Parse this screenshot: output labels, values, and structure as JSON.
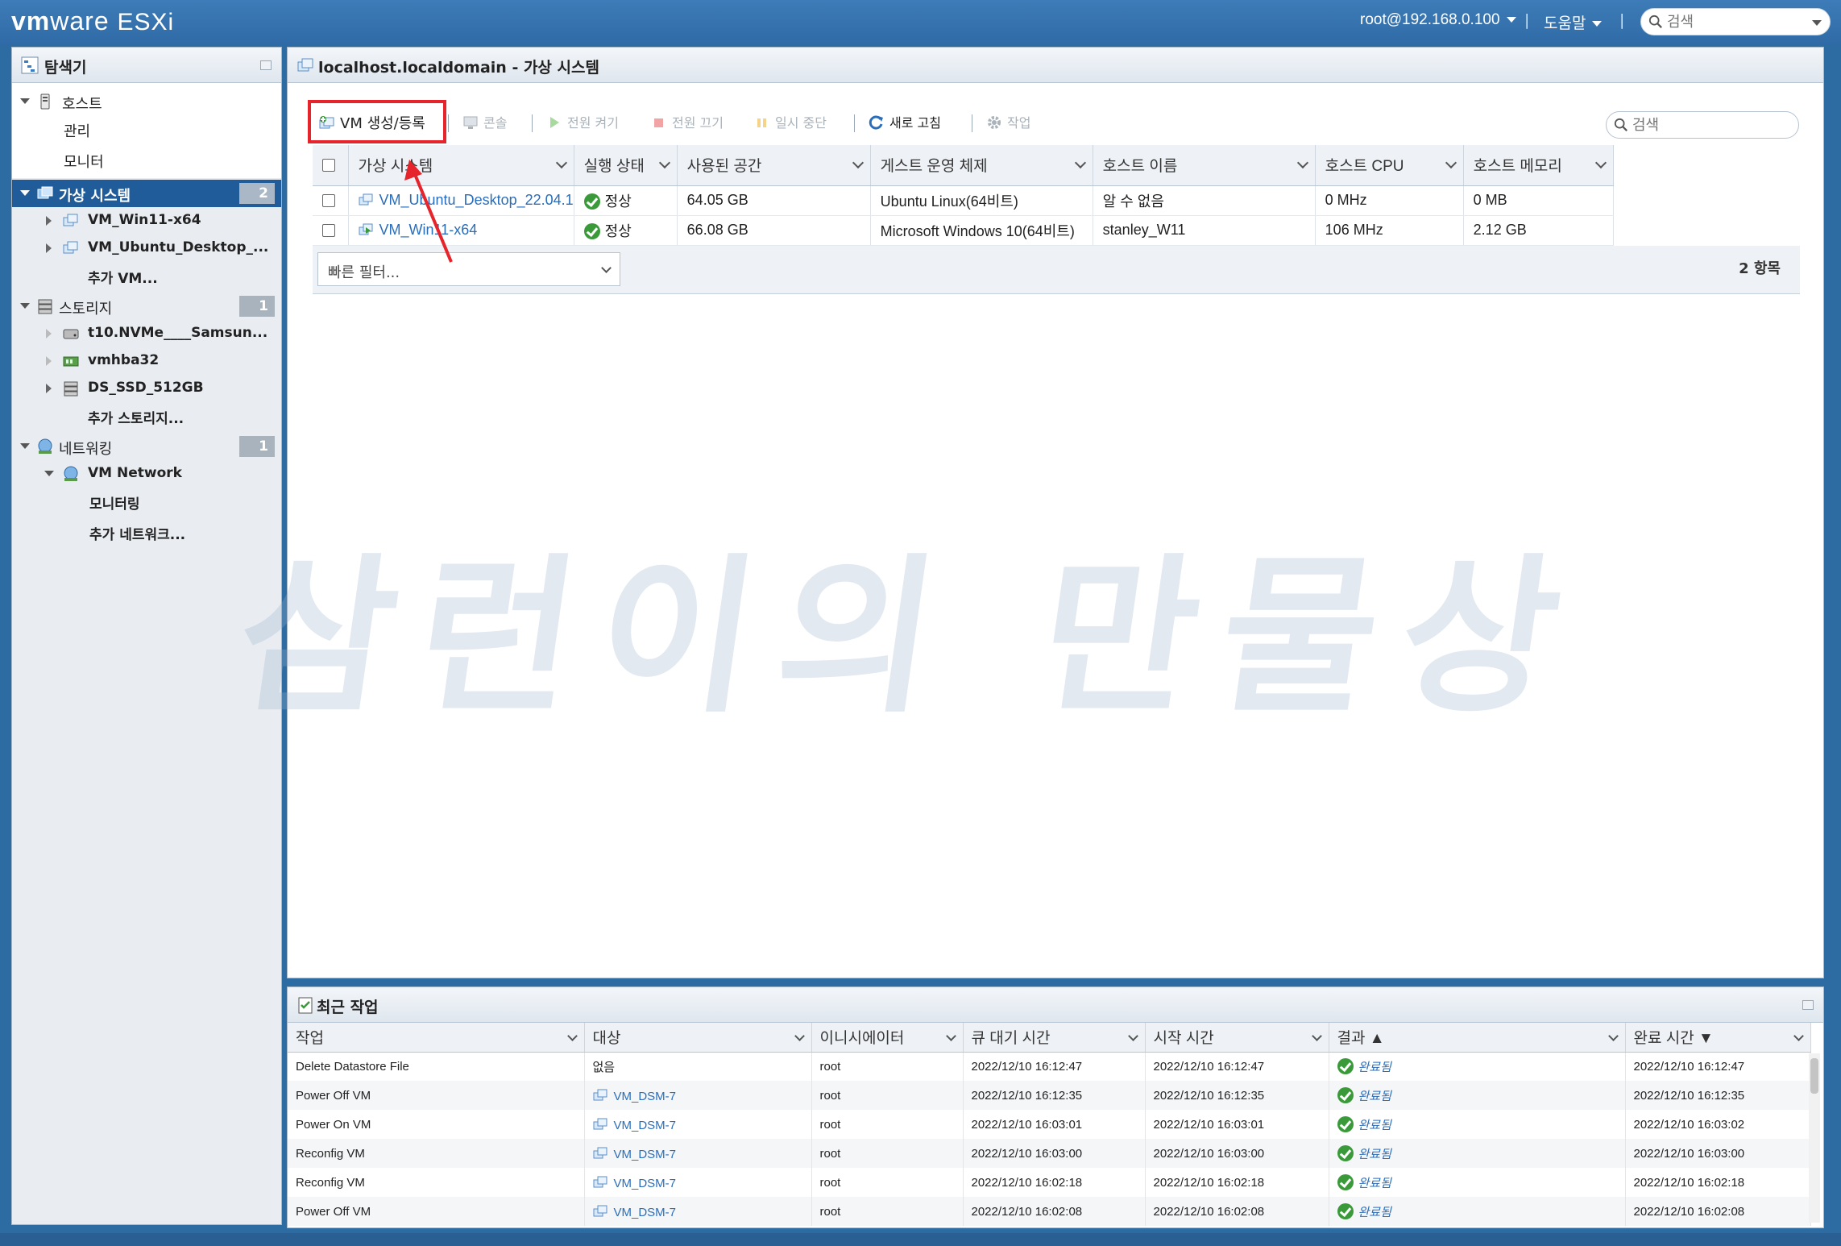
{
  "header": {
    "logo_vm": "vm",
    "logo_ware": "ware",
    "logo_product": "ESXi",
    "user": "root@192.168.0.100",
    "sep": "|",
    "help": "도움말",
    "search_placeholder": "검색"
  },
  "navigator": {
    "title": "탐색기",
    "items": [
      {
        "label": "호스트"
      },
      {
        "label": "관리"
      },
      {
        "label": "모니터"
      },
      {
        "label": "가상 시스템",
        "badge": "2"
      },
      {
        "label": "VM_Win11-x64"
      },
      {
        "label": "VM_Ubuntu_Desktop_..."
      },
      {
        "label": "추가 VM..."
      },
      {
        "label": "스토리지",
        "badge": "1"
      },
      {
        "label": "t10.NVMe____Samsun..."
      },
      {
        "label": "vmhba32"
      },
      {
        "label": "DS_SSD_512GB"
      },
      {
        "label": "추가 스토리지..."
      },
      {
        "label": "네트워킹",
        "badge": "1"
      },
      {
        "label": "VM Network"
      },
      {
        "label": "모니터링"
      },
      {
        "label": "추가 네트워크..."
      }
    ]
  },
  "main": {
    "title": "localhost.localdomain - 가상 시스템",
    "toolbar": {
      "create": "VM 생성/등록",
      "console": "콘솔",
      "power_on": "전원 켜기",
      "power_off": "전원 끄기",
      "suspend": "일시 중단",
      "refresh": "새로 고침",
      "actions": "작업"
    },
    "search_placeholder": "검색",
    "columns": [
      "가상 시스템",
      "실행 상태",
      "사용된 공간",
      "게스트 운영 체제",
      "호스트 이름",
      "호스트 CPU",
      "호스트 메모리"
    ],
    "rows": [
      {
        "name": "VM_Ubuntu_Desktop_22.04.1",
        "state": "정상",
        "used": "64.05 GB",
        "os": "Ubuntu Linux(64비트)",
        "host": "알 수 없음",
        "cpu": "0 MHz",
        "mem": "0 MB"
      },
      {
        "name": "VM_Win11-x64",
        "state": "정상",
        "used": "66.08 GB",
        "os": "Microsoft Windows 10(64비트)",
        "host": "stanley_W11",
        "cpu": "106 MHz",
        "mem": "2.12 GB"
      }
    ],
    "quick_filter": "빠른 필터...",
    "item_count": "2 항목"
  },
  "watermark": "삼런이의 만물상",
  "tasks": {
    "title": "최근 작업",
    "columns": [
      "작업",
      "대상",
      "이니시에이터",
      "큐 대기 시간",
      "시작 시간",
      "결과 ▲",
      "완료 시간 ▼"
    ],
    "rows": [
      {
        "task": "Delete Datastore File",
        "target": "없음",
        "init": "root",
        "queued": "2022/12/10 16:12:47",
        "started": "2022/12/10 16:12:47",
        "result": "완료됨",
        "completed": "2022/12/10 16:12:47"
      },
      {
        "task": "Power Off VM",
        "target": "VM_DSM-7",
        "init": "root",
        "queued": "2022/12/10 16:12:35",
        "started": "2022/12/10 16:12:35",
        "result": "완료됨",
        "completed": "2022/12/10 16:12:35"
      },
      {
        "task": "Power On VM",
        "target": "VM_DSM-7",
        "init": "root",
        "queued": "2022/12/10 16:03:01",
        "started": "2022/12/10 16:03:01",
        "result": "완료됨",
        "completed": "2022/12/10 16:03:02"
      },
      {
        "task": "Reconfig VM",
        "target": "VM_DSM-7",
        "init": "root",
        "queued": "2022/12/10 16:03:00",
        "started": "2022/12/10 16:03:00",
        "result": "완료됨",
        "completed": "2022/12/10 16:03:00"
      },
      {
        "task": "Reconfig VM",
        "target": "VM_DSM-7",
        "init": "root",
        "queued": "2022/12/10 16:02:18",
        "started": "2022/12/10 16:02:18",
        "result": "완료됨",
        "completed": "2022/12/10 16:02:18"
      },
      {
        "task": "Power Off VM",
        "target": "VM_DSM-7",
        "init": "root",
        "queued": "2022/12/10 16:02:08",
        "started": "2022/12/10 16:02:08",
        "result": "완료됨",
        "completed": "2022/12/10 16:02:08"
      }
    ]
  }
}
